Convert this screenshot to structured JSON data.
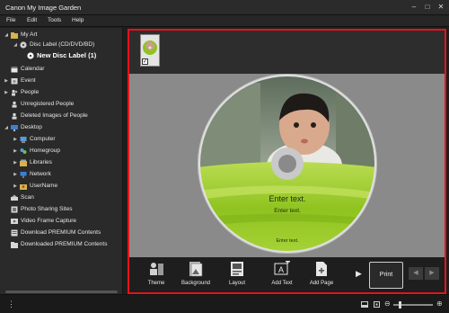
{
  "window": {
    "title": "Canon My Image Garden"
  },
  "menu": [
    "File",
    "Edit",
    "Tools",
    "Help"
  ],
  "tree": [
    {
      "label": "My Art",
      "icon": "folder-icon",
      "expanded": true
    },
    {
      "label": "Disc Label (CD/DVD/BD)",
      "icon": "disc-icon",
      "expanded": true
    },
    {
      "label": "New Disc Label (1)",
      "icon": "disc-label-icon",
      "selected": true
    },
    {
      "label": "Calendar",
      "icon": "calendar-icon"
    },
    {
      "label": "Event",
      "icon": "event-icon"
    },
    {
      "label": "People",
      "icon": "people-icon"
    },
    {
      "label": "Unregistered People",
      "icon": "person-icon"
    },
    {
      "label": "Deleted Images of People",
      "icon": "person-icon"
    },
    {
      "label": "Desktop",
      "icon": "desktop-icon",
      "expanded": true
    },
    {
      "label": "Computer",
      "icon": "computer-icon"
    },
    {
      "label": "Homegroup",
      "icon": "homegroup-icon"
    },
    {
      "label": "Libraries",
      "icon": "libraries-icon"
    },
    {
      "label": "Network",
      "icon": "network-icon"
    },
    {
      "label": "UserName",
      "icon": "user-folder-icon"
    },
    {
      "label": "Scan",
      "icon": "scan-icon"
    },
    {
      "label": "Photo Sharing Sites",
      "icon": "sharing-icon"
    },
    {
      "label": "Video Frame Capture",
      "icon": "video-icon"
    },
    {
      "label": "Download PREMIUM Contents",
      "icon": "download-icon"
    },
    {
      "label": "Downloaded PREMIUM Contents",
      "icon": "folder-icon"
    }
  ],
  "disc": {
    "main_text": "Enter text.",
    "sub_text": "Enter text.",
    "bottom_text": "Enter text.",
    "colors": {
      "green": "#8fc31f",
      "light_green": "#c6e264"
    }
  },
  "toolbar": {
    "items": [
      {
        "label": "Theme",
        "icon": "theme-icon"
      },
      {
        "label": "Background",
        "icon": "background-icon"
      },
      {
        "label": "Layout",
        "icon": "layout-icon"
      },
      {
        "label": "Add Text",
        "icon": "add-text-icon"
      },
      {
        "label": "Add Page",
        "icon": "add-page-icon"
      }
    ],
    "print_label": "Print"
  },
  "colors": {
    "highlight_frame": "#e3141e"
  }
}
